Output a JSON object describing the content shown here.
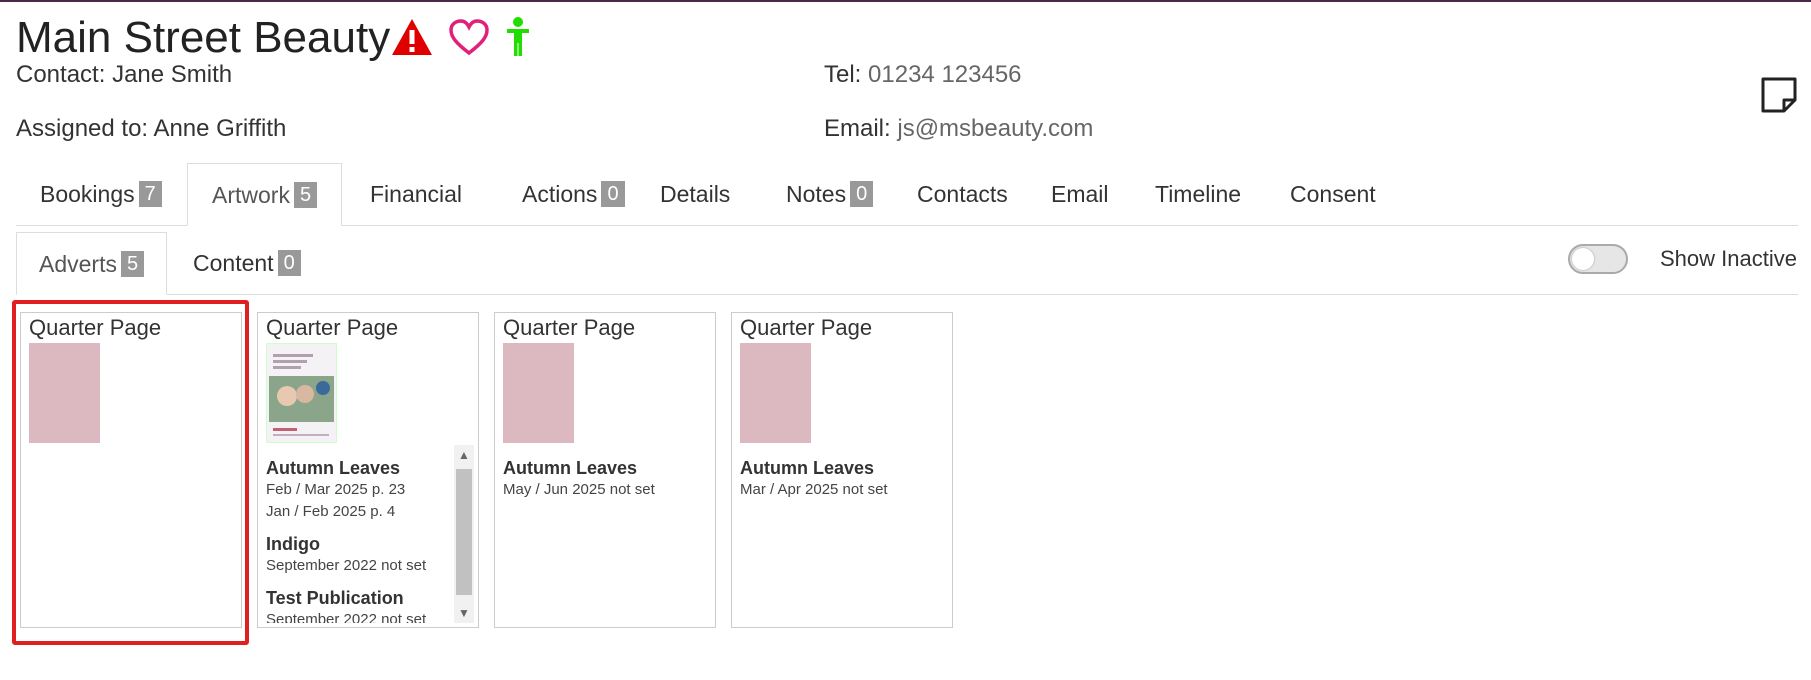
{
  "header": {
    "title": "Main Street Beauty",
    "contact_label": "Contact:",
    "contact_value": "Jane Smith",
    "assigned_label": "Assigned to:",
    "assigned_value": "Anne Griffith",
    "tel_label": "Tel:",
    "tel_value": "01234 123456",
    "email_label": "Email:",
    "email_value": "js@msbeauty.com",
    "icons": [
      "warning-icon",
      "heart-icon",
      "person-icon",
      "sticky-note-icon"
    ],
    "colors": {
      "warning": "#e00000",
      "heart": "#e0207a",
      "person": "#22dd00"
    }
  },
  "tabs": [
    {
      "label": "Bookings",
      "badge": "7"
    },
    {
      "label": "Artwork",
      "badge": "5",
      "active": true
    },
    {
      "label": "Financial"
    },
    {
      "label": "Actions",
      "badge": "0"
    },
    {
      "label": "Details"
    },
    {
      "label": "Notes",
      "badge": "0"
    },
    {
      "label": "Contacts"
    },
    {
      "label": "Email"
    },
    {
      "label": "Timeline"
    },
    {
      "label": "Consent"
    }
  ],
  "subtabs": [
    {
      "label": "Adverts",
      "badge": "5",
      "active": true
    },
    {
      "label": "Content",
      "badge": "0"
    }
  ],
  "show_inactive": {
    "label": "Show Inactive",
    "on": false
  },
  "cards": [
    {
      "title": "Quarter Page",
      "publications": []
    },
    {
      "title": "Quarter Page",
      "publications": [
        {
          "name": "Autumn Leaves",
          "issues": [
            "Feb / Mar 2025 p. 23",
            "Jan / Feb 2025 p. 4"
          ]
        },
        {
          "name": "Indigo",
          "issues": [
            "September 2022 not set"
          ]
        },
        {
          "name": "Test Publication",
          "issues": [
            "September 2022 not set"
          ]
        }
      ]
    },
    {
      "title": "Quarter Page",
      "publications": [
        {
          "name": "Autumn Leaves",
          "issues": [
            "May / Jun 2025 not set"
          ]
        }
      ]
    },
    {
      "title": "Quarter Page",
      "publications": [
        {
          "name": "Autumn Leaves",
          "issues": [
            "Mar / Apr 2025 not set"
          ]
        }
      ]
    }
  ]
}
